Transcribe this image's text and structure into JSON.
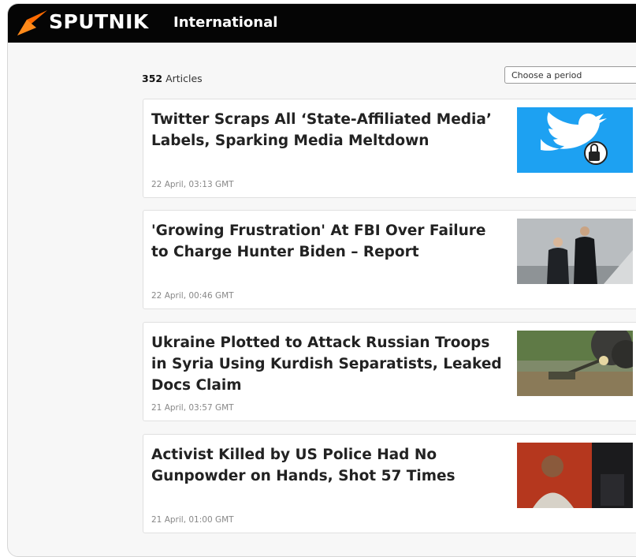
{
  "header": {
    "logo_text": "SPUTNIK",
    "edition": "International",
    "brand_color": "#ff6a00"
  },
  "list": {
    "count_number": "352",
    "count_label": " Articles",
    "period_placeholder": "Choose a period"
  },
  "articles": [
    {
      "title": "Twitter Scraps All ‘State-Affiliated Media’ Labels, Sparking Media Meltdown",
      "date": "22 April, 03:13 GMT",
      "thumb": "twitter-logo-lock-image"
    },
    {
      "title": "'Growing Frustration' At FBI Over Failure to Charge Hunter Biden – Report",
      "date": "22 April, 00:46 GMT",
      "thumb": "two-men-walking-image"
    },
    {
      "title": "Ukraine Plotted to Attack Russian Troops in Syria Using Kurdish Separatists, Leaked Docs Claim",
      "date": "21 April, 03:57 GMT",
      "thumb": "artillery-firing-image"
    },
    {
      "title": "Activist Killed by US Police Had No Gunpowder on Hands, Shot 57 Times",
      "date": "21 April, 01:00 GMT",
      "thumb": "protest-portrait-image"
    }
  ]
}
